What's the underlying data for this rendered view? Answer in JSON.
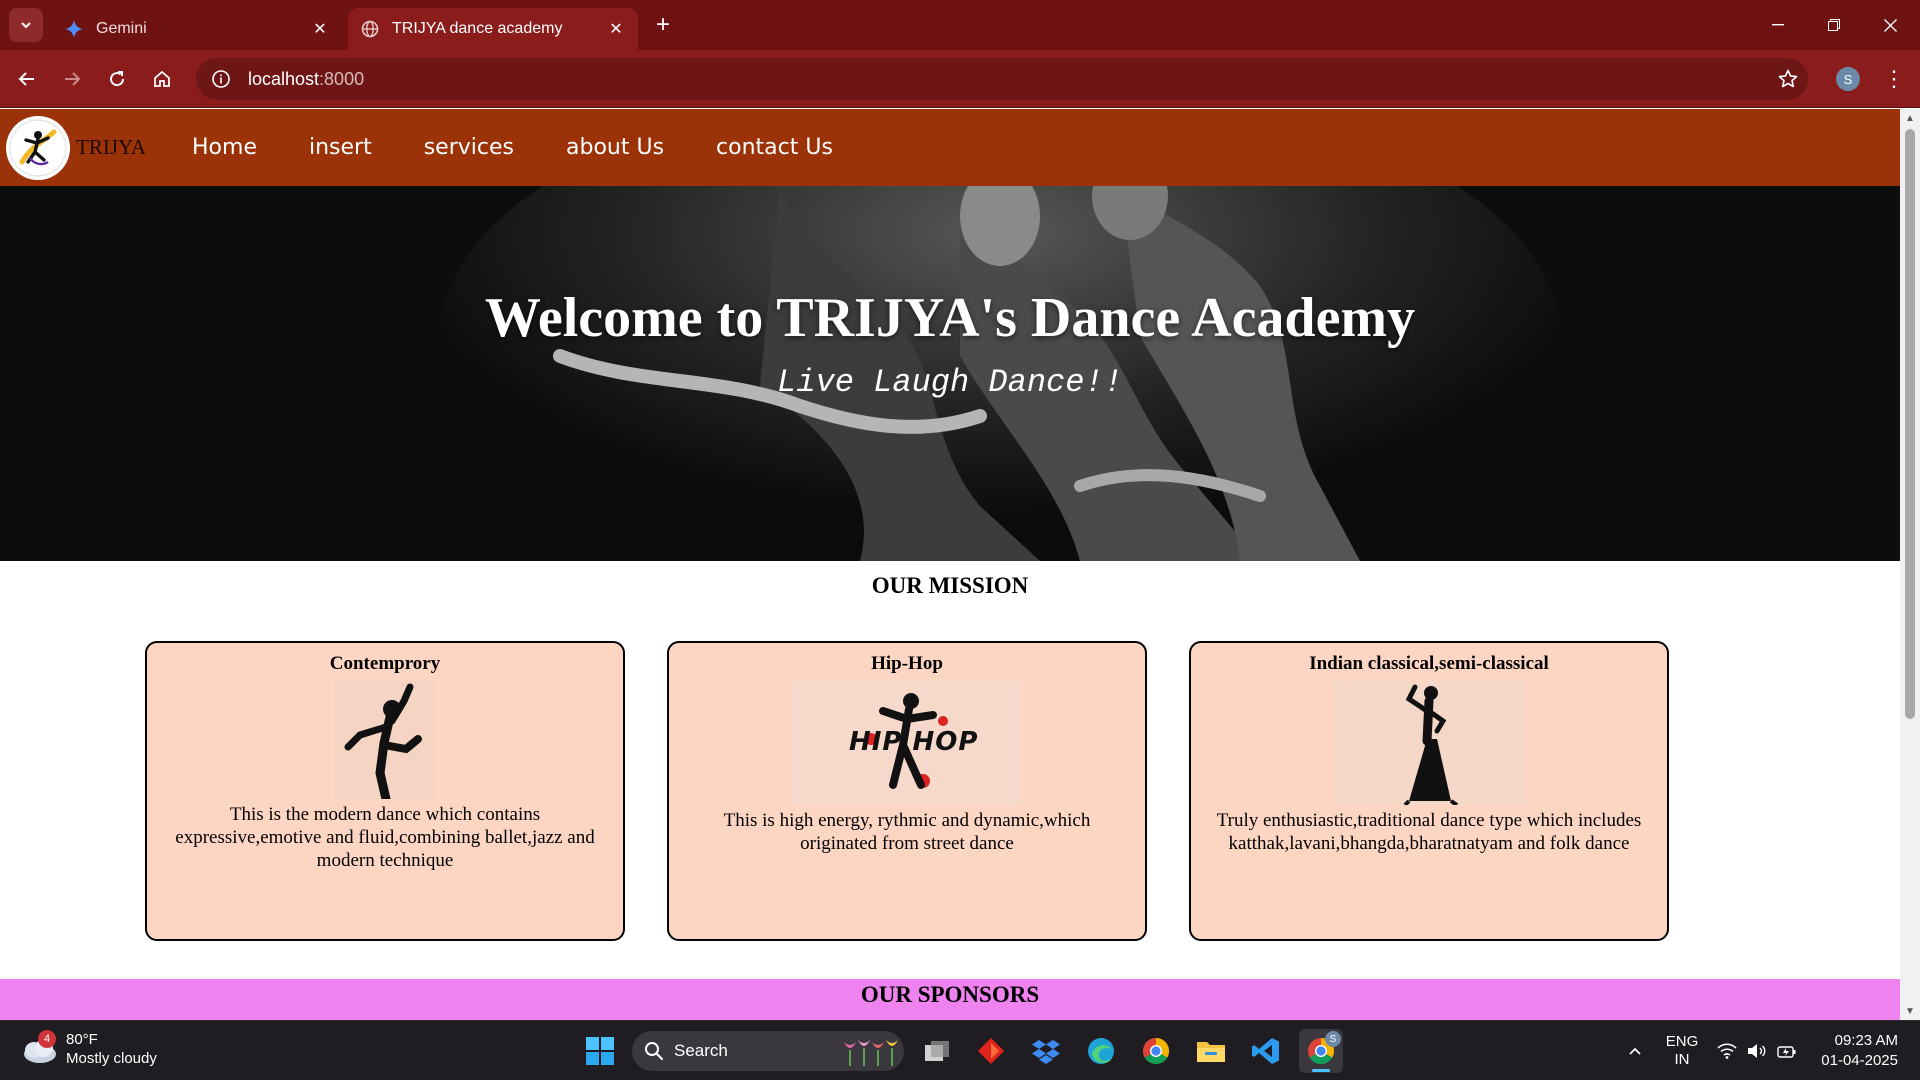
{
  "browser": {
    "tabs": [
      {
        "title": "Gemini",
        "active": false
      },
      {
        "title": "TRIJYA dance academy",
        "active": true
      }
    ],
    "address": {
      "host": "localhost",
      "port": ":8000"
    },
    "profile_initial": "S"
  },
  "site": {
    "brand": "TRIJYA",
    "nav": [
      "Home",
      "insert",
      "services",
      "about Us",
      "contact Us"
    ],
    "hero": {
      "title": "Welcome to TRIJYA's Dance Academy",
      "tagline": "Live Laugh Dance!!"
    },
    "mission": {
      "title": "OUR MISSION",
      "cards": [
        {
          "title": "Contemprory",
          "text": "This is the modern dance which contains expressive,emotive and fluid,combining ballet,jazz and modern technique"
        },
        {
          "title": "Hip-Hop",
          "image_text": "HIP HOP",
          "text": "This is high energy, rythmic and dynamic,which originated from street dance"
        },
        {
          "title": "Indian classical,semi-classical",
          "text": "Truly enthusiastic,traditional dance type which includes katthak,lavani,bhangda,bharatnatyam and folk dance"
        }
      ]
    },
    "sponsors_title": "OUR SPONSORS",
    "colors": {
      "nav": "#9c3308",
      "card": "#fdd5c3",
      "sponsors": "#ee82ee"
    }
  },
  "taskbar": {
    "weather": {
      "badge": "4",
      "temp": "80°F",
      "condition": "Mostly cloudy"
    },
    "search_label": "Search",
    "lang": {
      "line1": "ENG",
      "line2": "IN"
    },
    "clock": {
      "time": "09:23 AM",
      "date": "01-04-2025"
    },
    "chrome_badge": "S"
  }
}
